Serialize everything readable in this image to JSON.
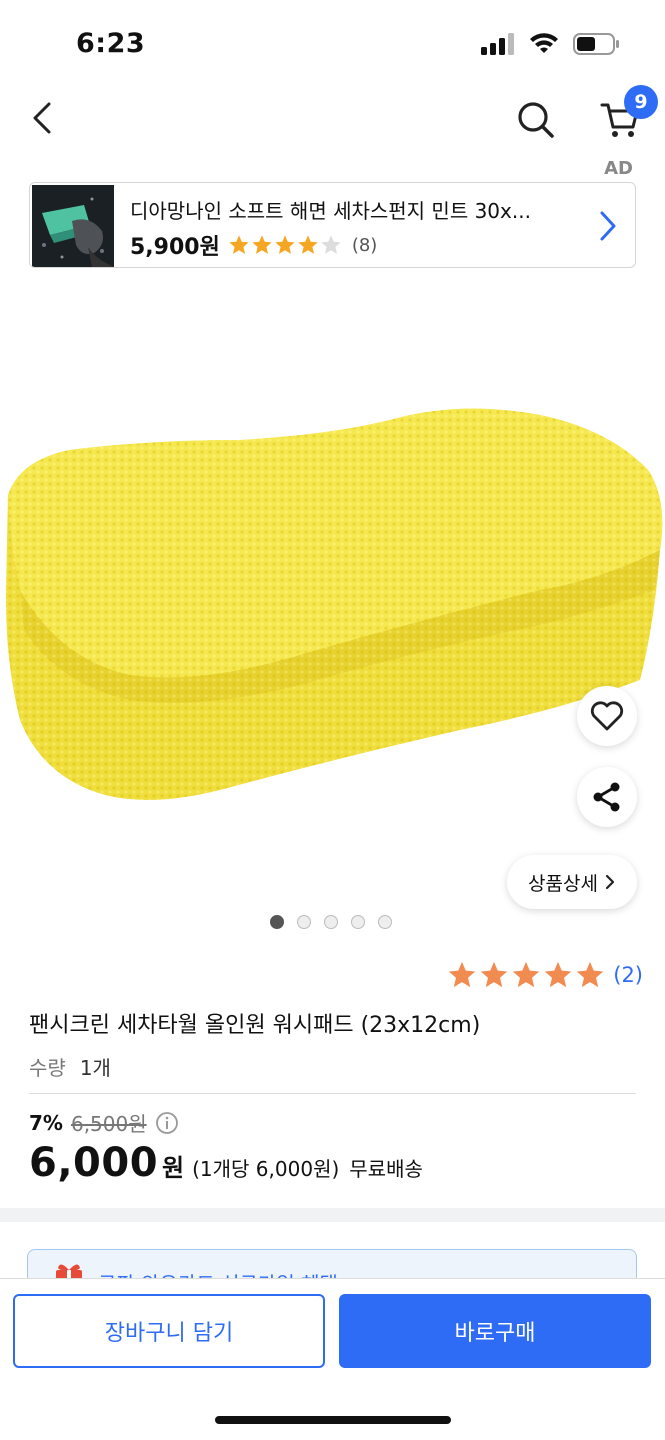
{
  "status_bar": {
    "time": "6:23",
    "icons": [
      "cellular-icon",
      "wifi-icon",
      "battery-icon"
    ]
  },
  "nav": {
    "cart_count": "9",
    "icons": [
      "back-arrow-icon",
      "search-icon",
      "cart-icon"
    ]
  },
  "ad": {
    "label": "AD",
    "title": "디아망나인 소프트 해면 세차스펀지 민트 30x...",
    "price": "5,900원",
    "rating": 4,
    "rating_max": 5,
    "review_count": "(8)"
  },
  "hero": {
    "detail_label": "상품상세",
    "image_count": 5,
    "active_index": 0,
    "icons": [
      "heart-icon",
      "share-icon",
      "chevron-right-icon"
    ]
  },
  "product": {
    "rating": 5,
    "review_count": "(2)",
    "title": "팬시크린 세차타월 올인원 워시패드 (23x12cm)",
    "qty_label": "수량",
    "qty_value": "1개",
    "discount": "7%",
    "original_price": "6,500원",
    "price": "6,000",
    "price_unit": "원",
    "unit_price": "(1개당 6,000원)",
    "shipping": "무료배송"
  },
  "promo": {
    "text": "쿠팡 와우카드 신규가입 혜택"
  },
  "bottom": {
    "add_to_cart": "장바구니 담기",
    "buy_now": "바로구매"
  },
  "colors": {
    "accent": "#2f6cf6",
    "star": "#f5a623",
    "product_star": "#f28b50"
  }
}
